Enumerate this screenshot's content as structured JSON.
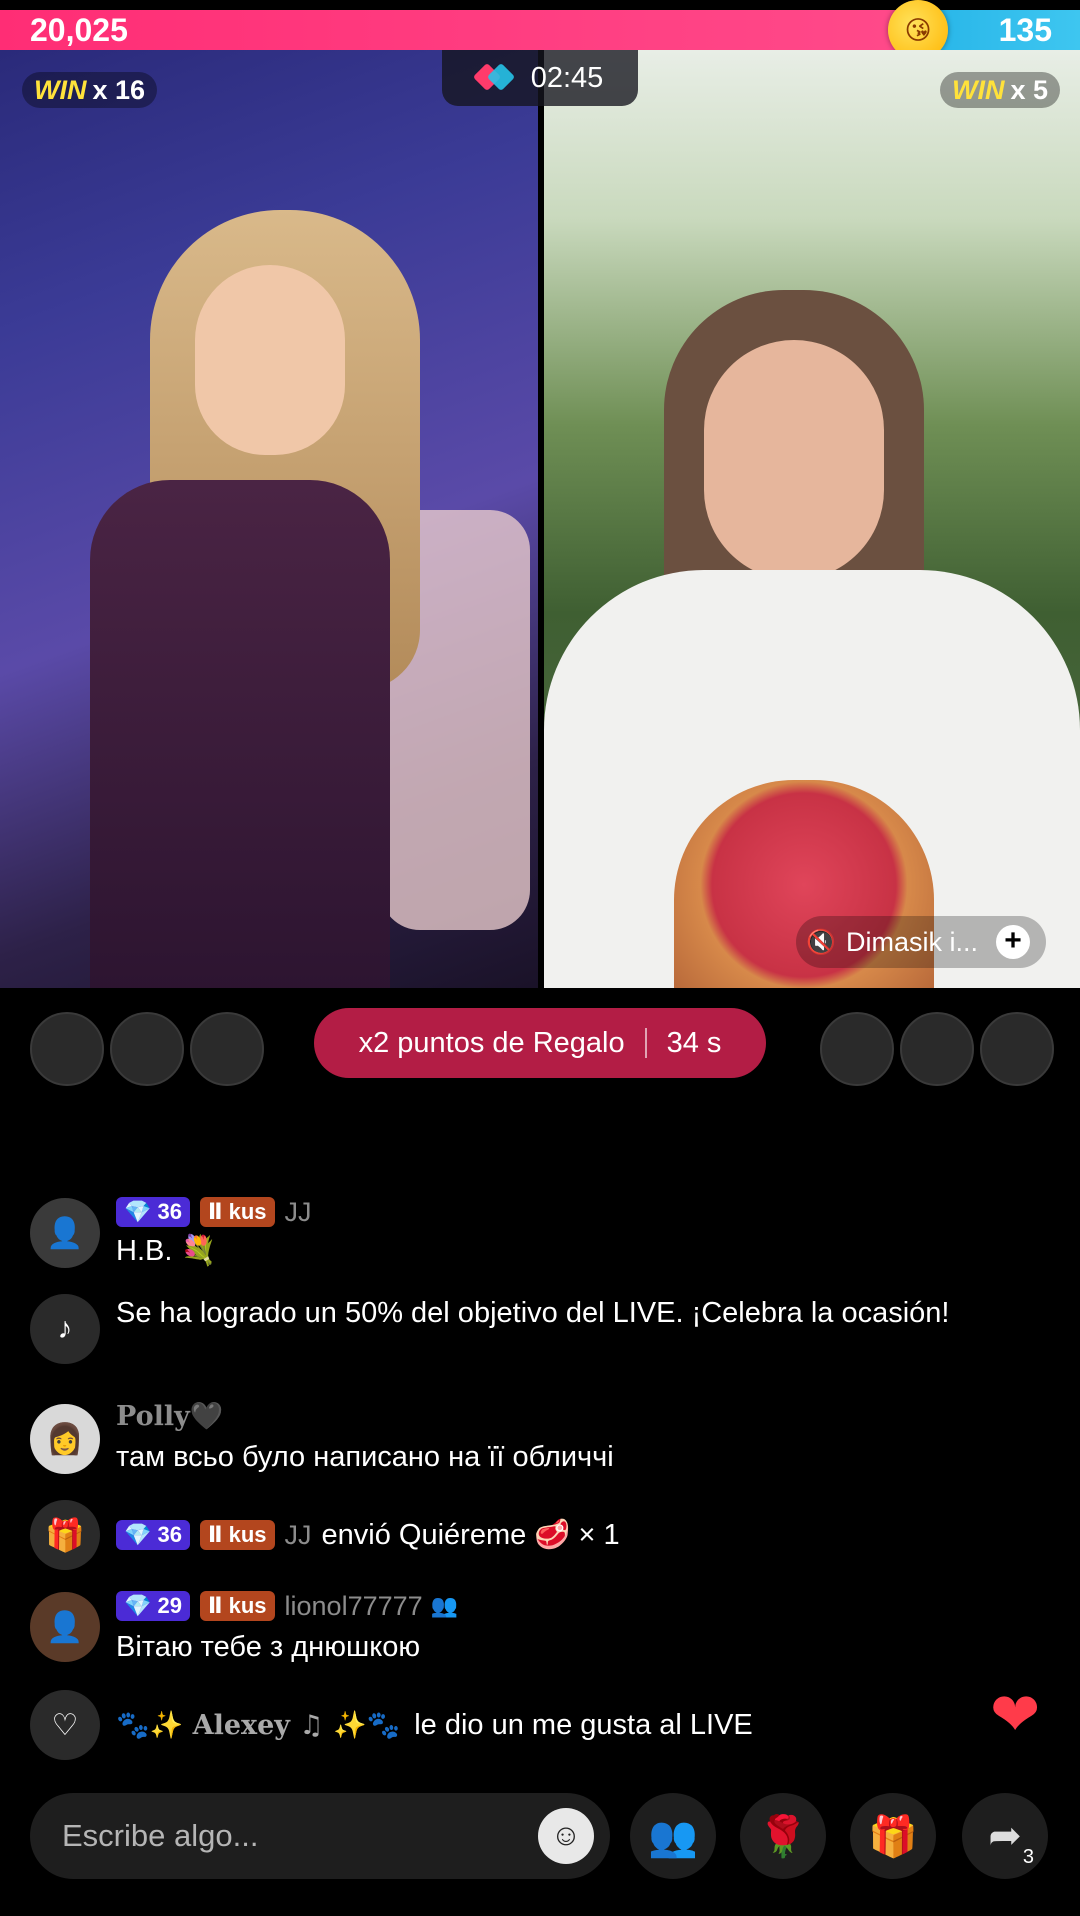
{
  "battle": {
    "score_left": "20,025",
    "score_right": "135",
    "share_left": 0.85,
    "color_left": "#ff2d75",
    "color_right": "#27b5e8",
    "marker_icon": "kiss-emoji-icon"
  },
  "streamers": {
    "left_win_label": "WIN",
    "left_win_count": "x 16",
    "right_win_label": "WIN",
    "right_win_count": "x 5",
    "guest_name": "Dimasik i..."
  },
  "timer": "02:45",
  "gift_banner": {
    "label": "x2 puntos de Regalo",
    "seconds": "34 s",
    "color": "#b31d45"
  },
  "chat": [
    {
      "type": "user",
      "level": "36",
      "team": "kus",
      "user": "JJ",
      "text": "Н.В. 💐"
    },
    {
      "type": "system",
      "text": "Se ha logrado un 50% del objetivo del LIVE. ¡Celebra la ocasión!"
    },
    {
      "type": "user",
      "user": "Polly🖤",
      "text": "там всьо було написано на її обличчі"
    },
    {
      "type": "gift",
      "level": "36",
      "team": "kus",
      "user": "JJ",
      "text": "envió Quiéreme 🥩 × 1"
    },
    {
      "type": "user",
      "level": "29",
      "team": "kus",
      "user": "lionol77777",
      "text": "Вітаю тебе з днюшкою"
    },
    {
      "type": "like",
      "user": "🐾✨ Alexey ♫ ✨🐾",
      "text": "le dio un me gusta al LIVE"
    }
  ],
  "input": {
    "placeholder": "Escribe algo..."
  },
  "actions": {
    "share_count": "3"
  }
}
